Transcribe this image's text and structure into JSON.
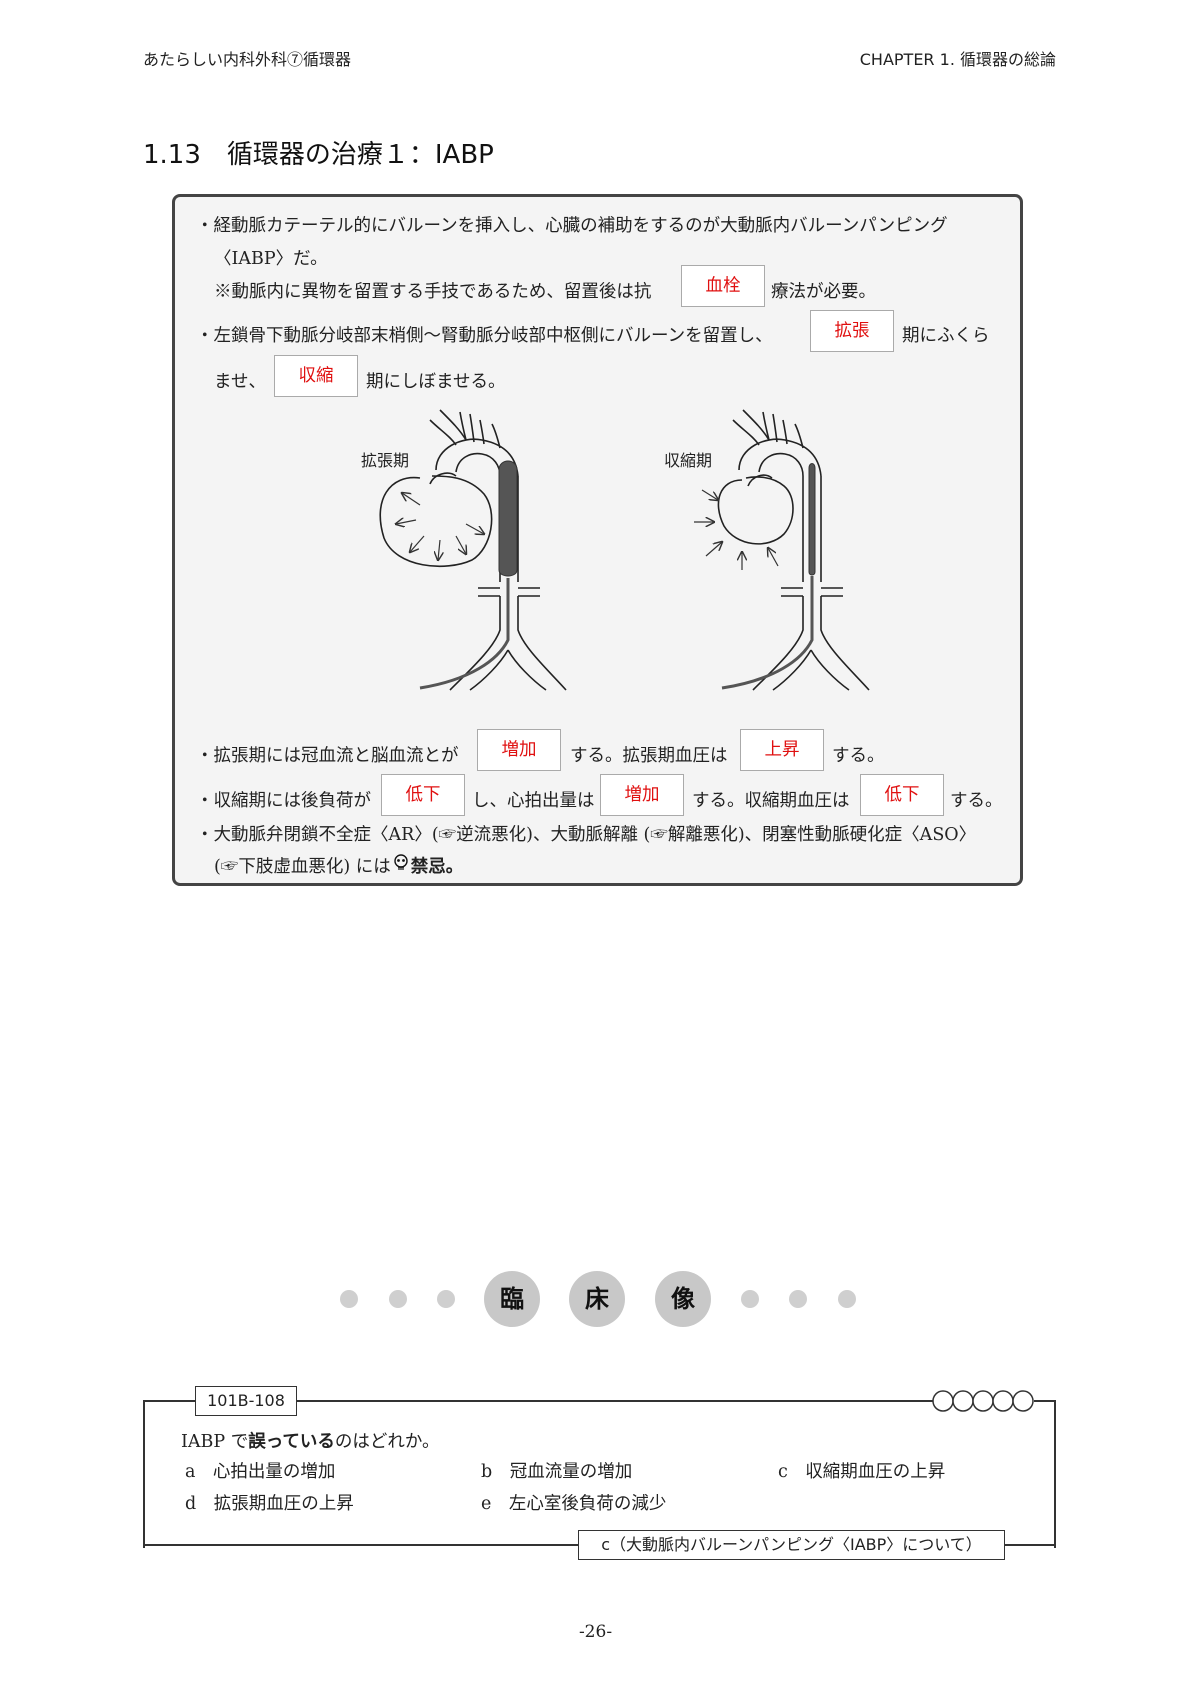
{
  "header": {
    "left": "あたらしい内科外科⑦循環器",
    "right": "CHAPTER 1. 循環器の総論"
  },
  "section_title": "1.13　循環器の治療１：IABP",
  "box": {
    "b1_line1": "・経動脈カテーテル的にバルーンを挿入し、心臓の補助をするのが大動脈内バルーンパンピング",
    "b1_line2": "〈IABP〉だ。",
    "b1_line3_pre": "※動脈内に異物を留置する手技であるため、留置後は抗",
    "b1_line3_answer": "血栓",
    "b1_line3_post": "療法が必要。",
    "b2_pre": "・左鎖骨下動脈分岐部末梢側〜腎動脈分岐部中枢側にバルーンを留置し、",
    "b2_answer1": "拡張",
    "b2_mid": "期にふくら",
    "b2_line2_pre": "ませ、",
    "b2_answer2": "収縮",
    "b2_line2_post": "期にしぼませる。",
    "fig_label_diastole": "拡張期",
    "fig_label_systole": "収縮期",
    "b3_pre": "・拡張期には冠血流と脳血流とが",
    "b3_answer1": "増加",
    "b3_mid": "する。拡張期血圧は",
    "b3_answer2": "上昇",
    "b3_post": "する。",
    "b4_pre": "・収縮期には後負荷が",
    "b4_answer1": "低下",
    "b4_mid1": "し、心拍出量は",
    "b4_answer2": "増加",
    "b4_mid2": "する。収縮期血圧は",
    "b4_answer3": "低下",
    "b4_post": "する。",
    "b5_line1": "・大動脈弁閉鎖不全症〈AR〉(☞逆流悪化)、大動脈解離 (☞解離悪化)、閉塞性動脈硬化症〈ASO〉",
    "b5_line2_pre": "(☞下肢虚血悪化) には",
    "b5_line2_icon": "skull-icon",
    "b5_line2_post": "禁忌。"
  },
  "clinical": {
    "c1": "臨",
    "c2": "床",
    "c3": "像"
  },
  "question": {
    "id": "101B-108",
    "stem_pre": "IABP で",
    "stem_bold": "誤っている",
    "stem_post": "のはどれか。",
    "options": {
      "a": "a　心拍出量の増加",
      "b": "b　冠血流量の増加",
      "c": "c　収縮期血圧の上昇",
      "d": "d　拡張期血圧の上昇",
      "e": "e　左心室後負荷の減少"
    },
    "answer": "c（大動脈内バルーンパンピング〈IABP〉について）"
  },
  "page_number": "-26-"
}
